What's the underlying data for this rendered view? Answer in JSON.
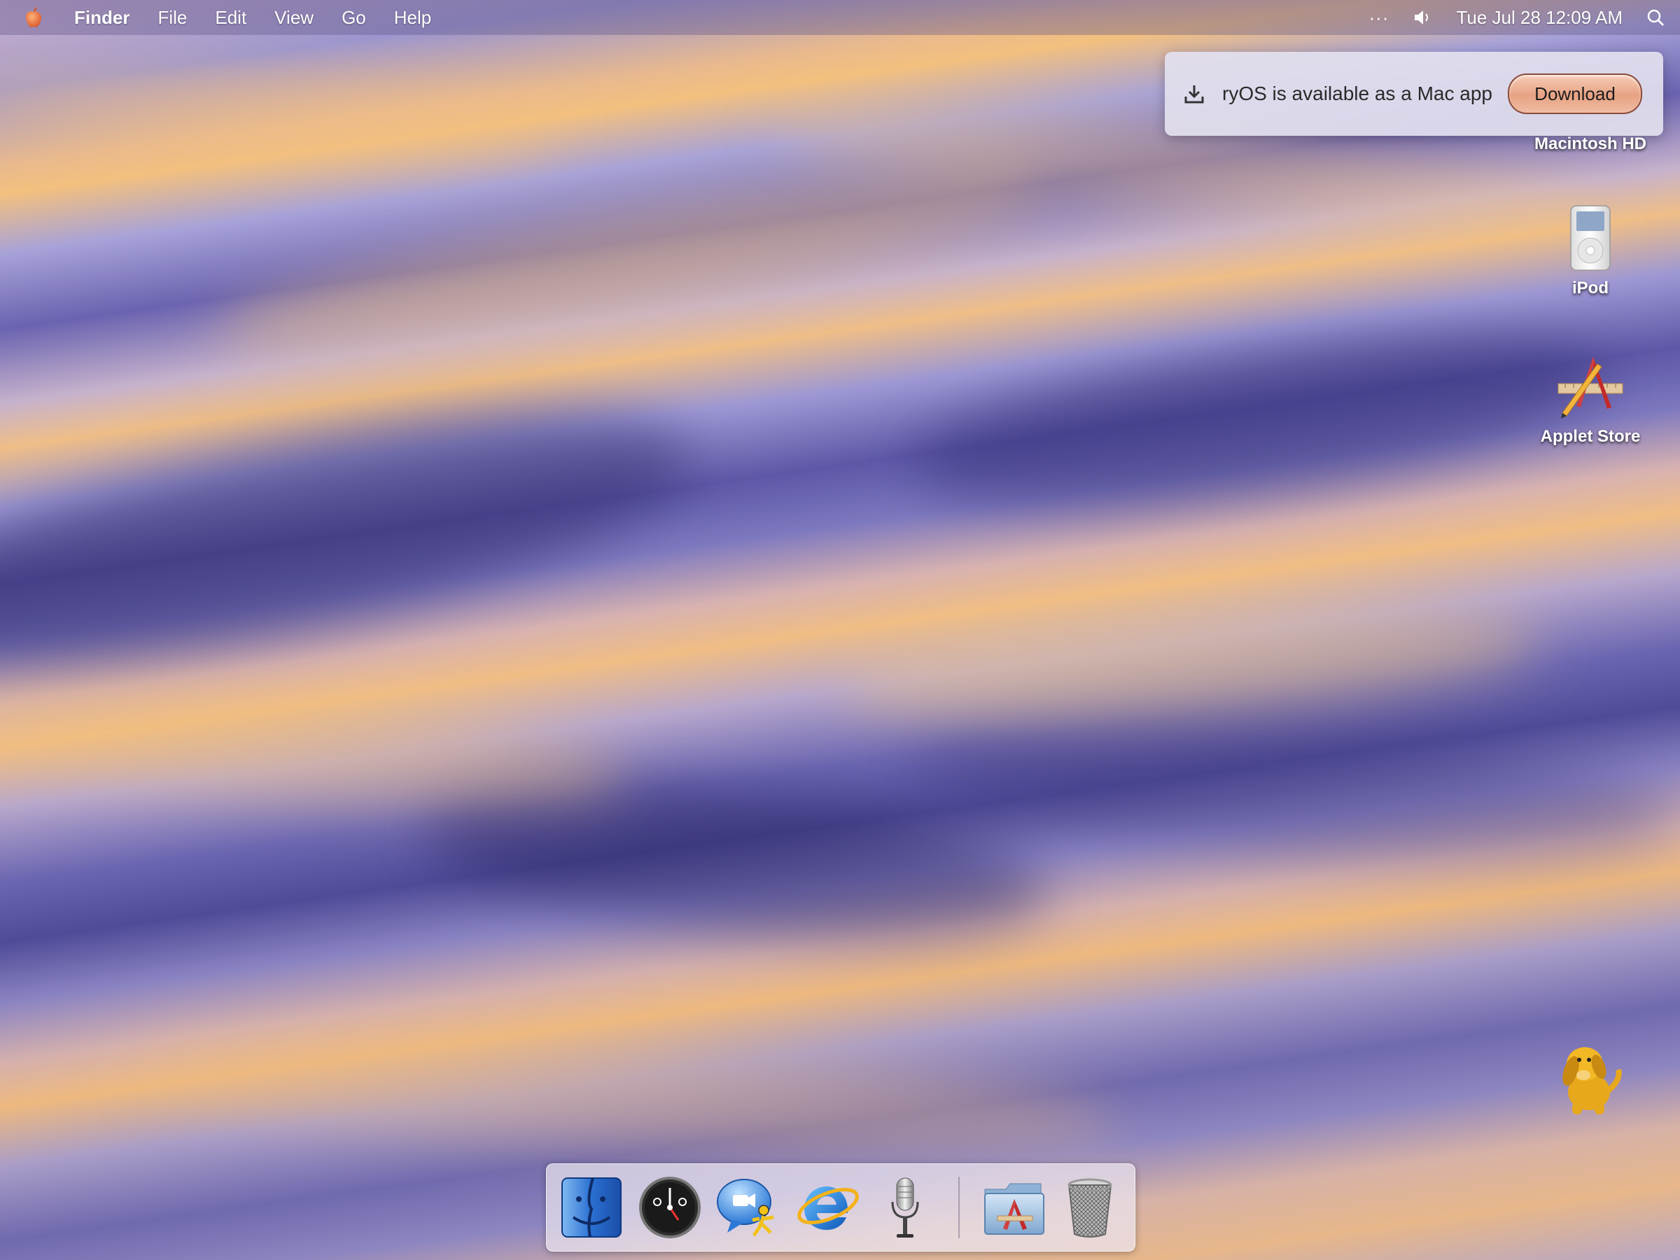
{
  "menubar": {
    "apple_icon": "apple-icon",
    "app_name": "Finder",
    "menus": [
      "File",
      "Edit",
      "View",
      "Go",
      "Help"
    ],
    "overflow_glyph": "···",
    "volume_icon": "speaker-icon",
    "clock": "Tue Jul 28 12:09 AM",
    "search_icon": "spotlight-search-icon"
  },
  "notification": {
    "icon": "download-icon",
    "message": "ryOS is available as a Mac app",
    "button_label": "Download",
    "button_color": "#e8a283"
  },
  "desktop_icons": [
    {
      "label": "Macintosh HD",
      "icon": "hard-drive-icon"
    },
    {
      "label": "iPod",
      "icon": "ipod-icon"
    },
    {
      "label": "Applet Store",
      "icon": "applet-store-icon"
    }
  ],
  "dock": {
    "items": [
      {
        "name": "Finder",
        "icon": "finder-icon"
      },
      {
        "name": "Dashboard",
        "icon": "dashboard-icon"
      },
      {
        "name": "iChat",
        "icon": "ichat-icon"
      },
      {
        "name": "Internet Explorer",
        "icon": "internet-explorer-icon"
      },
      {
        "name": "Microphone",
        "icon": "microphone-icon"
      },
      {
        "name": "Applications",
        "icon": "applications-folder-icon"
      },
      {
        "name": "Trash",
        "icon": "trash-icon"
      }
    ]
  },
  "assistant": {
    "icon": "dog-assistant-icon"
  }
}
